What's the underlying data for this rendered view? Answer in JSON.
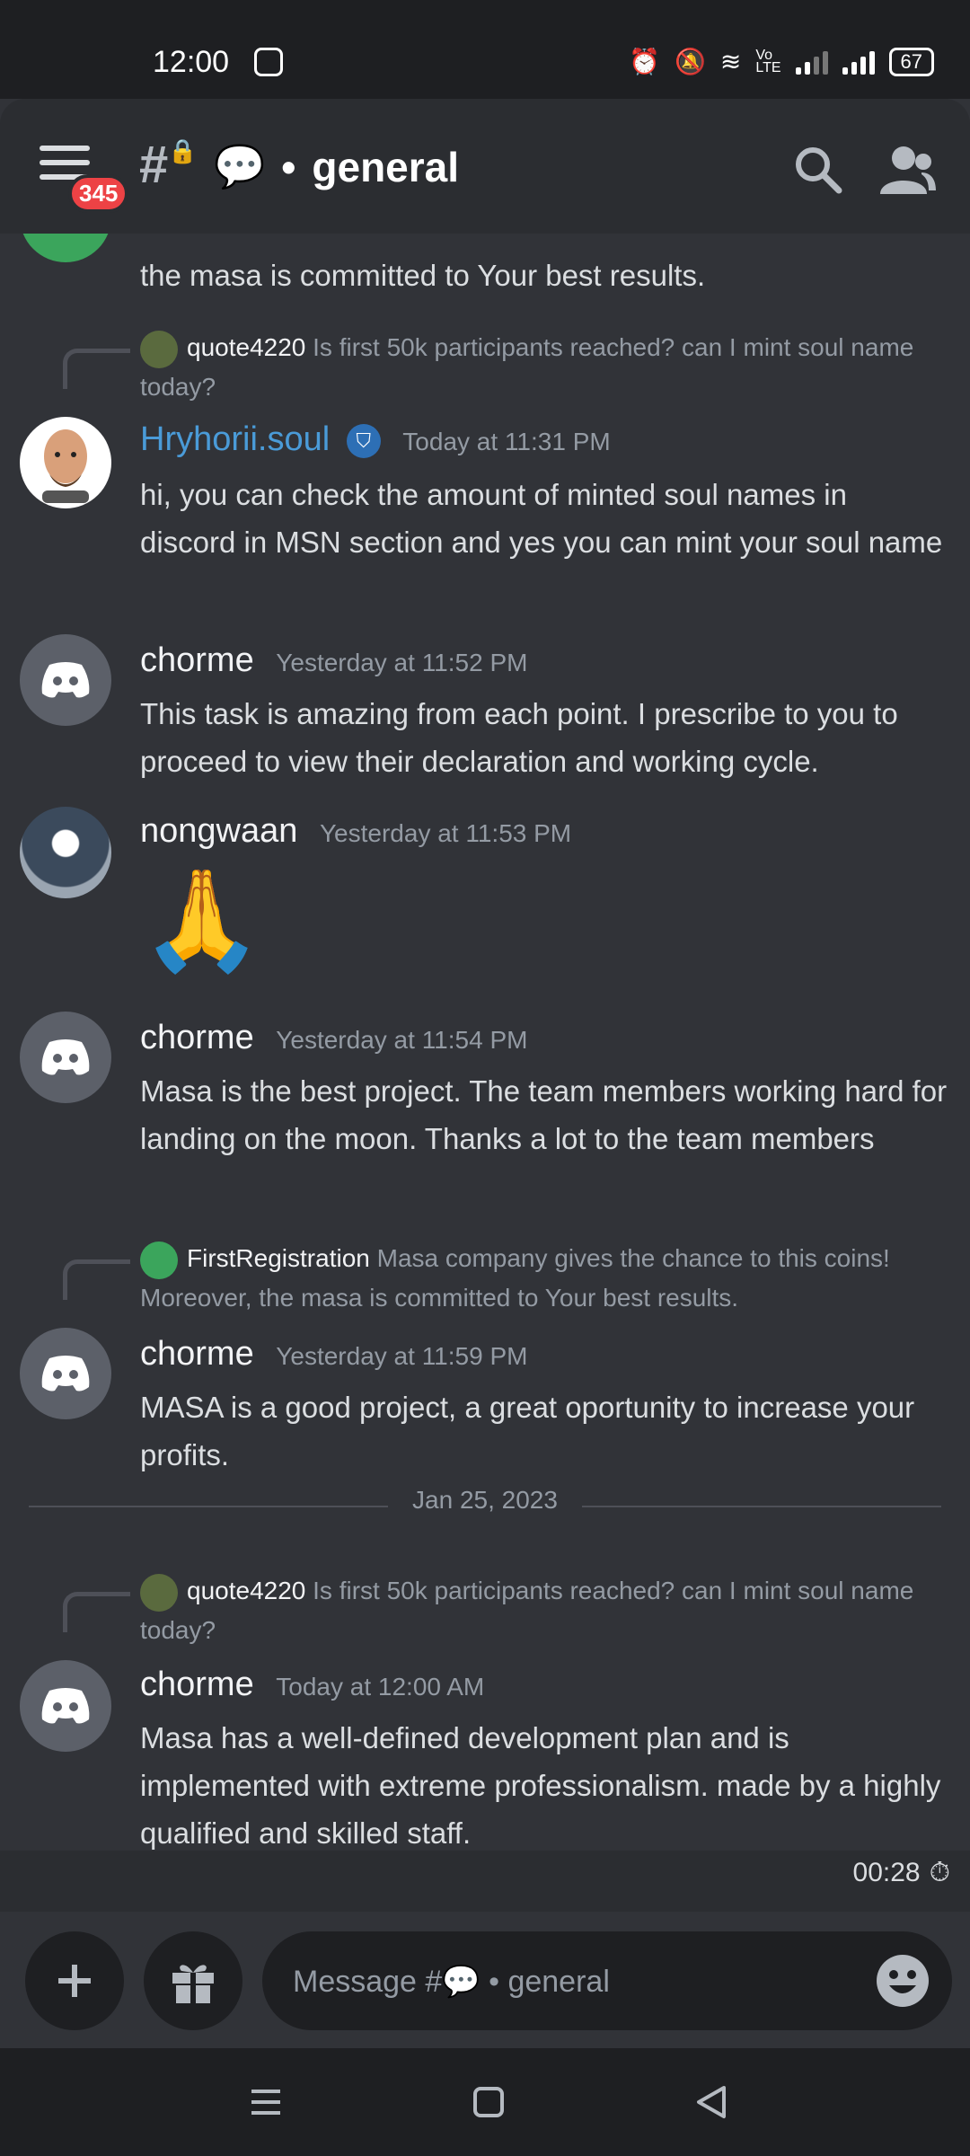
{
  "status_bar": {
    "time": "12:00",
    "battery": "67"
  },
  "header": {
    "badge": "345",
    "channel_name": "general"
  },
  "chat": {
    "top_partial": "the masa is committed to Your best results.",
    "messages": [
      {
        "reply": {
          "author": "quote4220",
          "text": "Is first 50k participants reached? can I mint soul name today?"
        },
        "author": "Hryhorii.soul",
        "timestamp": "Today at 11:31 PM",
        "text": "hi, you can check the amount of minted soul names in discord in  MSN section  and yes you can mint your soul name"
      },
      {
        "author": "chorme",
        "timestamp": "Yesterday at 11:52 PM",
        "text": "This task is amazing from each point. I prescribe to you to proceed to view their declaration and working cycle."
      },
      {
        "author": "nongwaan",
        "timestamp": "Yesterday at 11:53 PM",
        "text": "🙏"
      },
      {
        "author": "chorme",
        "timestamp": "Yesterday at 11:54 PM",
        "text": "Masa is the best project. The team members working hard for landing on the moon. Thanks a lot to the team members"
      },
      {
        "reply": {
          "author": "FirstRegistration",
          "text": "Masa company gives the chance to this coins! Moreover, the masa is committed to Your best results."
        },
        "author": "chorme",
        "timestamp": "Yesterday at 11:59 PM",
        "text": "MASA is a good project, a great oportunity to increase your profits."
      },
      {
        "reply": {
          "author": "quote4220",
          "text": "Is first 50k participants reached? can I mint soul name today?"
        },
        "author": "chorme",
        "timestamp": "Today at 12:00 AM",
        "text": "Masa has a well-defined development plan and is implemented with extreme professionalism. made by a highly qualified and skilled staff."
      }
    ],
    "date_divider": "Jan 25, 2023"
  },
  "composer": {
    "timer": "00:28",
    "placeholder": "Message #💬 • general"
  },
  "colors": {
    "background": "#313338",
    "header": "#2b2d31",
    "link_author": "#4a9bd8",
    "badge": "#ed4245"
  }
}
